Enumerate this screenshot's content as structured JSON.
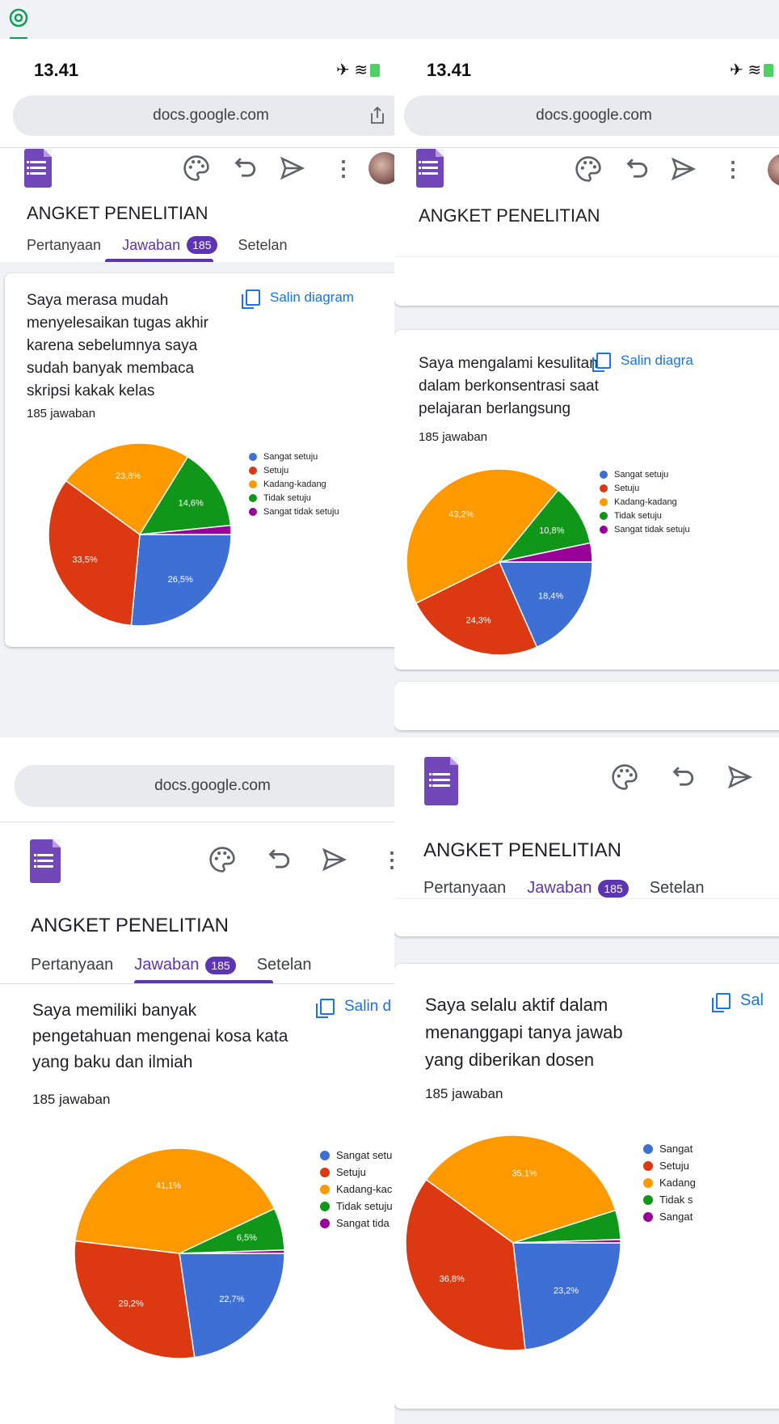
{
  "colors": {
    "sangat_setuju": "#3d6fd4",
    "setuju": "#dc3912",
    "kadang": "#ff9900",
    "tidak_setuju": "#109618",
    "sangat_tidak_setuju": "#990099",
    "purple": "#5e35b1",
    "link": "#1a73e8"
  },
  "icons": [
    "google-lens-icon",
    "share-icon",
    "palette-icon",
    "undo-icon",
    "send-icon",
    "more-vert-icon",
    "copy-icon",
    "forms-icon",
    "airplane-icon",
    "wifi-icon",
    "battery-icon"
  ],
  "status": {
    "time": "13.41"
  },
  "browser": {
    "url": "docs.google.com"
  },
  "form": {
    "title": "ANGKET PENELITIAN",
    "tabs": {
      "questions": "Pertanyaan",
      "responses": "Jawaban",
      "responses_count": "185",
      "settings": "Setelan"
    },
    "copy_chart": "Salin diagram",
    "copy_chart_cut2": "Salin diagra",
    "copy_chart_cut3": "Salin d",
    "copy_chart_cut4": "Sal"
  },
  "legend": {
    "full": [
      "Sangat setuju",
      "Setuju",
      "Kadang-kadang",
      "Tidak setuju",
      "Sangat tidak setuju"
    ],
    "cut3": [
      "Sangat setu",
      "Setuju",
      "Kadang-kac",
      "Tidak setuju",
      "Sangat tida"
    ],
    "cut4": [
      "Sangat",
      "Setuju",
      "Kadang",
      "Tidak s",
      "Sangat"
    ]
  },
  "chart_data": [
    {
      "type": "pie",
      "title": "Saya merasa mudah menyelesaikan tugas akhir karena sebelumnya saya sudah banyak membaca skripsi kakak kelas",
      "subtitle": "185 jawaban",
      "categories": [
        "Sangat setuju",
        "Setuju",
        "Kadang-kadang",
        "Tidak setuju",
        "Sangat tidak setuju"
      ],
      "values": [
        26.5,
        33.5,
        23.8,
        14.6,
        1.6
      ],
      "data_labels": [
        "26,5%",
        "33,5%",
        "23,8%",
        "14,6%",
        ""
      ],
      "legend_position": "right"
    },
    {
      "type": "pie",
      "title": "Saya mengalami kesulitan dalam berkonsentrasi saat pelajaran berlangsung",
      "subtitle": "185 jawaban",
      "categories": [
        "Sangat setuju",
        "Setuju",
        "Kadang-kadang",
        "Tidak setuju",
        "Sangat tidak setuju"
      ],
      "values": [
        18.4,
        24.3,
        43.2,
        10.8,
        3.3
      ],
      "data_labels": [
        "18,4%",
        "24,3%",
        "43,2%",
        "10,8%",
        ""
      ],
      "legend_position": "right"
    },
    {
      "type": "pie",
      "title": "Saya memiliki banyak pengetahuan mengenai kosa kata yang baku dan ilmiah",
      "subtitle": "185 jawaban",
      "categories": [
        "Sangat setuju",
        "Setuju",
        "Kadang-kadang",
        "Tidak setuju",
        "Sangat tidak setuju"
      ],
      "values": [
        22.7,
        29.2,
        41.1,
        6.5,
        0.5
      ],
      "data_labels": [
        "22,7%",
        "29,2%",
        "41,1%",
        "6,5%",
        ""
      ],
      "legend_position": "right"
    },
    {
      "type": "pie",
      "title": "Saya selalu aktif dalam menanggapi tanya jawab yang diberikan dosen",
      "subtitle": "185 jawaban",
      "categories": [
        "Sangat setuju",
        "Setuju",
        "Kadang-kadang",
        "Tidak setuju",
        "Sangat tidak setuju"
      ],
      "values": [
        23.2,
        36.8,
        35.1,
        4.4,
        0.5
      ],
      "data_labels": [
        "23,2%",
        "36,8%",
        "35,1%",
        "",
        ""
      ],
      "legend_position": "right"
    }
  ]
}
